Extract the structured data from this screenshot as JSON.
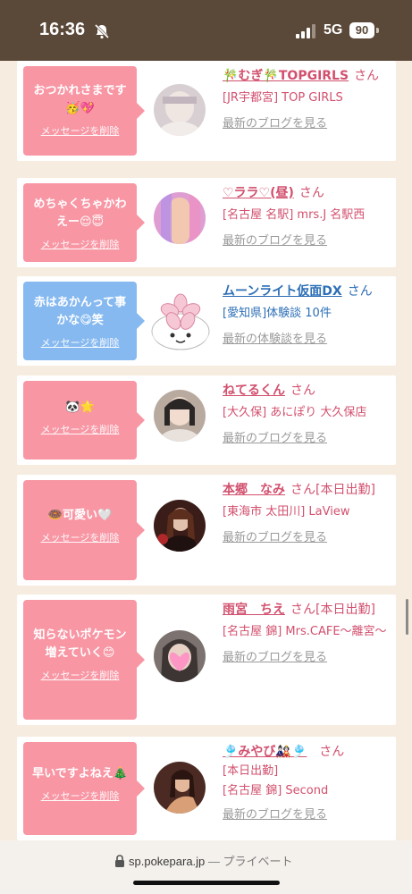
{
  "status_bar": {
    "time": "16:36",
    "network": "5G",
    "battery": "90"
  },
  "url_bar": {
    "domain": "sp.pokepara.jp",
    "separator": " — ",
    "privacy": "プライベート"
  },
  "common": {
    "delete_label": "メッセージを削除",
    "san": "さん",
    "blog_link": "最新のブログを見る",
    "review_link": "最新の体験談を見る"
  },
  "cards": [
    {
      "message": "おつかれさまです🥳💖",
      "name": "🎋むぎ🎋TOPGIRLS",
      "shop": "[JR宇都宮] TOP GIRLS",
      "link": "最新のブログを見る",
      "bubble_color": "#f896a4"
    },
    {
      "message": "めちゃくちゃかわえー😌😇",
      "name": "♡ララ♡(昼)",
      "shop": "[名古屋 名駅] mrs.J 名駅西",
      "link": "最新のブログを見る",
      "bubble_color": "#f896a4"
    },
    {
      "message": "赤はあかんって事かな😋笑",
      "name": "ムーンライト仮面DX",
      "shop": "[愛知県]体験談 10件",
      "link": "最新の体験談を見る",
      "bubble_color": "#86b9f0"
    },
    {
      "message": "🐼🌟",
      "name": "ねてるくん",
      "shop": "[大久保] あにぽり 大久保店",
      "link": "最新のブログを見る",
      "bubble_color": "#f896a4"
    },
    {
      "message": "🍩可愛い🤍",
      "name": "本郷　なみ",
      "extra": "[本日出勤]",
      "shop": "[東海市 太田川] LaView",
      "link": "最新のブログを見る",
      "bubble_color": "#f896a4"
    },
    {
      "message": "知らないポケモン増えていく😊",
      "name": "雨宮　ちえ",
      "extra": "[本日出勤]",
      "shop": "[名古屋 錦] Mrs.CAFE〜離宮〜",
      "link": "最新のブログを見る",
      "bubble_color": "#f896a4"
    },
    {
      "message": "早いですよねえ🎄",
      "name": "🎐みやび🎎🎐",
      "extra": "[本日出勤]",
      "shop": "[名古屋 錦] Second",
      "link": "最新のブログを見る",
      "bubble_color": "#f896a4"
    }
  ]
}
